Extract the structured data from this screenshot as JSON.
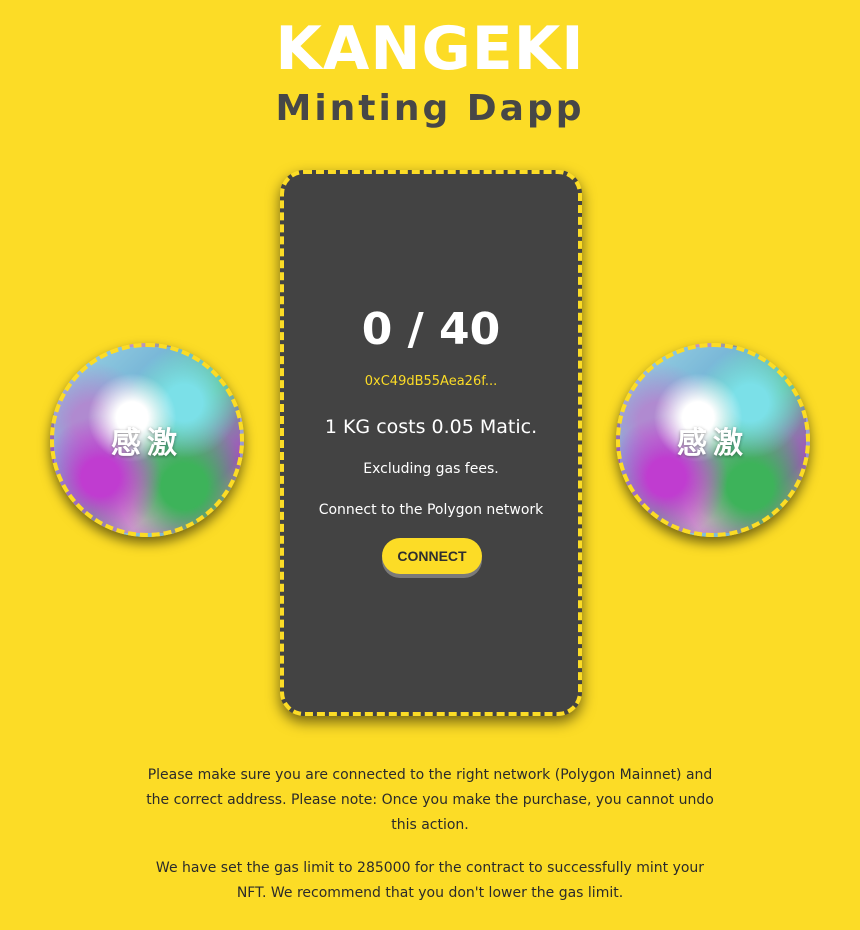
{
  "header": {
    "logo": "KANGEKI",
    "subtitle": "Minting Dapp"
  },
  "side_images": {
    "left_text": "感激",
    "right_text": "感激"
  },
  "mint_card": {
    "supply_text": "0 / 40",
    "contract_address": "0xC49dB55Aea26f...",
    "cost_text": "1 KG costs 0.05 Matic.",
    "gas_text": "Excluding gas fees.",
    "network_prompt": "Connect to the Polygon network",
    "connect_label": "CONNECT"
  },
  "footer": {
    "notice_network": "Please make sure you are connected to the right network (Polygon Mainnet) and the correct address. Please note: Once you make the purchase, you cannot undo this action.",
    "notice_gas": "We have set the gas limit to 285000 for the contract to successfully mint your NFT. We recommend that you don't lower the gas limit."
  },
  "colors": {
    "background": "#fcdc26",
    "card": "#434343",
    "accent": "#fcdc26",
    "text_dark": "#474747"
  }
}
